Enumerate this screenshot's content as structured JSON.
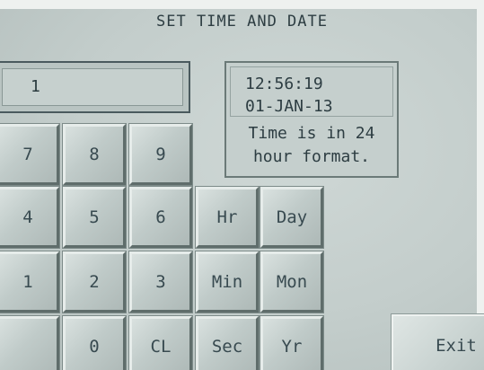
{
  "title": "SET TIME AND DATE",
  "entry": {
    "value": "1"
  },
  "clock": {
    "time": "12:56:19",
    "date": "01-JAN-13",
    "note_line1": "Time is in 24",
    "note_line2": "hour format."
  },
  "keypad": {
    "k7": "7",
    "k8": "8",
    "k9": "9",
    "k4": "4",
    "k5": "5",
    "k6": "6",
    "k1": "1",
    "k2": "2",
    "k3": "3",
    "k0": "0",
    "clear": "CL"
  },
  "fields": {
    "hour": "Hr",
    "day": "Day",
    "minute": "Min",
    "month": "Mon",
    "second": "Sec",
    "year": "Yr"
  },
  "exit_label": "Exit"
}
